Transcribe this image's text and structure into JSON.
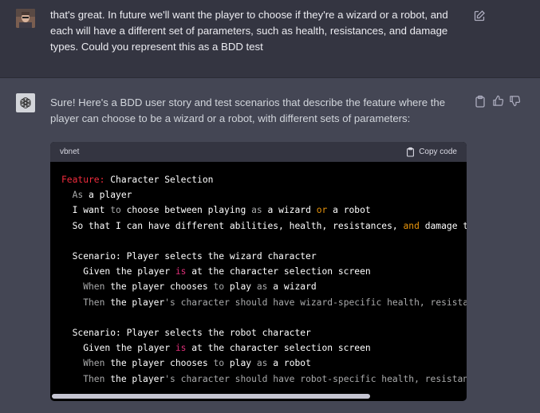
{
  "user_message": {
    "text": "that's great. In future we'll want the player to choose if they're a wizard or a robot, and each will have a different set of parameters, such as health, resistances, and damage types. Could you represent this as a BDD test"
  },
  "assistant_message": {
    "text": "Sure! Here's a BDD user story and test scenarios that describe the feature where the player can choose to be a wizard or a robot, with different sets of parameters:"
  },
  "code_block": {
    "language": "vbnet",
    "copy_label": "Copy code",
    "lines": [
      [
        {
          "t": "Feature:",
          "c": "kw"
        },
        {
          "t": " Character Selection",
          "c": "white"
        }
      ],
      [
        {
          "t": "  As",
          "c": "dim"
        },
        {
          "t": " a player",
          "c": "white"
        }
      ],
      [
        {
          "t": "  I want ",
          "c": "white"
        },
        {
          "t": "to",
          "c": "dim"
        },
        {
          "t": " choose between playing ",
          "c": "white"
        },
        {
          "t": "as",
          "c": "dim"
        },
        {
          "t": " a wizard ",
          "c": "white"
        },
        {
          "t": "or",
          "c": "op"
        },
        {
          "t": " a robot",
          "c": "white"
        }
      ],
      [
        {
          "t": "  So that I can have different abilities, health, resistances, ",
          "c": "white"
        },
        {
          "t": "and",
          "c": "op"
        },
        {
          "t": " damage types",
          "c": "white"
        }
      ],
      [
        {
          "t": "",
          "c": "white"
        }
      ],
      [
        {
          "t": "  Scenario: Player selects the wizard character",
          "c": "white"
        }
      ],
      [
        {
          "t": "    Given the player ",
          "c": "white"
        },
        {
          "t": "is",
          "c": "red"
        },
        {
          "t": " at the character selection screen",
          "c": "white"
        }
      ],
      [
        {
          "t": "    When",
          "c": "dim"
        },
        {
          "t": " the player chooses ",
          "c": "white"
        },
        {
          "t": "to",
          "c": "dim"
        },
        {
          "t": " play ",
          "c": "white"
        },
        {
          "t": "as",
          "c": "dim"
        },
        {
          "t": " a wizard",
          "c": "white"
        }
      ],
      [
        {
          "t": "    Then",
          "c": "dim"
        },
        {
          "t": " the player",
          "c": "white"
        },
        {
          "t": "'s character should have wizard-specific health, resistances",
          "c": "dim"
        }
      ],
      [
        {
          "t": "",
          "c": "white"
        }
      ],
      [
        {
          "t": "  Scenario: Player selects the robot character",
          "c": "white"
        }
      ],
      [
        {
          "t": "    Given the player ",
          "c": "white"
        },
        {
          "t": "is",
          "c": "red"
        },
        {
          "t": " at the character selection screen",
          "c": "white"
        }
      ],
      [
        {
          "t": "    When",
          "c": "dim"
        },
        {
          "t": " the player chooses ",
          "c": "white"
        },
        {
          "t": "to",
          "c": "dim"
        },
        {
          "t": " play ",
          "c": "white"
        },
        {
          "t": "as",
          "c": "dim"
        },
        {
          "t": " a robot",
          "c": "white"
        }
      ],
      [
        {
          "t": "    Then",
          "c": "dim"
        },
        {
          "t": " the player",
          "c": "white"
        },
        {
          "t": "'s character should have robot-specific health, resistances",
          "c": "dim"
        }
      ]
    ],
    "scroll_fraction_visible": 0.77
  },
  "colors": {
    "user_bg": "#343541",
    "assistant_bg": "#444654",
    "code_bg": "#000000",
    "code_header_bg": "#343541",
    "keyword": "#f22c3d",
    "operator": "#e9950c"
  },
  "icons": {
    "edit": "pencil-square-icon",
    "copy": "clipboard-icon",
    "like": "thumbs-up-icon",
    "dislike": "thumbs-down-icon",
    "assistant_logo": "openai-logo-icon",
    "user_avatar": "user-photo-avatar"
  }
}
